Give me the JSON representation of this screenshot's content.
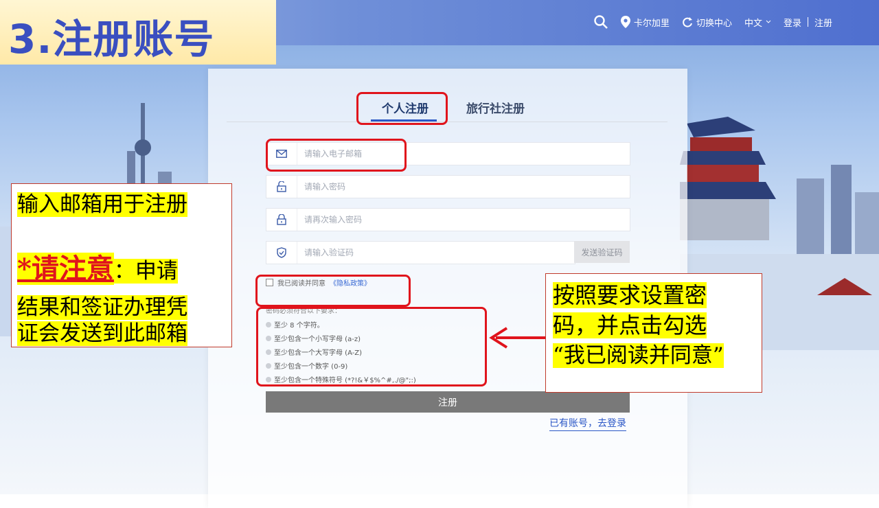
{
  "slide": {
    "title": "3.注册账号"
  },
  "nav": {
    "location": "卡尔加里",
    "switch_center": "切换中心",
    "language": "中文",
    "login": "登录",
    "register": "注册",
    "icons": [
      "search-icon",
      "location-pin-icon",
      "refresh-icon",
      "chevron-down-icon"
    ]
  },
  "tabs": {
    "personal": "个人注册",
    "agency": "旅行社注册"
  },
  "form": {
    "email_placeholder": "请输入电子邮箱",
    "password_placeholder": "请输入密码",
    "confirm_placeholder": "请再次输入密码",
    "code_placeholder": "请输入验证码",
    "send_code": "发送验证码",
    "agree_text": "我已阅读并同意",
    "privacy_link": "《隐私政策》",
    "req_title": "密码必须符合以下要求：",
    "requirements": [
      "至少 8 个字符。",
      "至少包含一个小写字母 (a-z)",
      "至少包含一个大写字母 (A-Z)",
      "至少包含一个数字 (0-9)",
      "至少包含一个特殊符号 (*?!&￥$%^#,./@\";:)"
    ],
    "submit": "注册",
    "login_link": "已有账号，去登录"
  },
  "notes": {
    "left_line1": "输入邮箱用于注册",
    "left_warn": "*请注意",
    "left_colon": "：申请",
    "left_line3": "结果和签证办理凭",
    "left_line4": "证会发送到此邮箱",
    "right_line1": "按照要求设置密",
    "right_line2": "码，并点击勾选",
    "right_line3": "“我已阅读并同意”"
  },
  "colors": {
    "annotation_red": "#e0141c",
    "highlight": "#ffff00",
    "title_blue": "#3a4fc0",
    "accent_blue": "#2a56c6"
  }
}
